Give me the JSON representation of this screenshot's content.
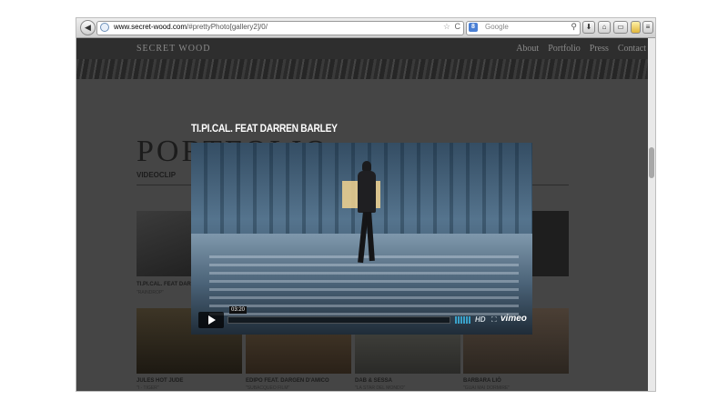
{
  "browser": {
    "url_host": "www.secret-wood.com",
    "url_path": "/#prettyPhoto[gallery2]/0/",
    "search_engine_label": "8",
    "search_placeholder": "Google"
  },
  "site": {
    "logo": "SECRET WOOD",
    "nav": [
      "About",
      "Portfolio",
      "Press",
      "Contact"
    ],
    "page_heading": "PORTFOLIO",
    "section_label": "VIDEOCLIP",
    "thumbs": [
      {
        "title": "TI.PI.CAL. FEAT DARREN B",
        "subtitle": "\"RAINDROP\""
      },
      {
        "title": "JULES HOT JUDE",
        "subtitle": "\"I - TIGER\""
      },
      {
        "title": "EDIPO FEAT. DARGEN D'AMICO",
        "subtitle": "\"SUBACQUEO FILM\""
      },
      {
        "title": "DAB & SESSA",
        "subtitle": "\"LA STAR DEL MONDO\""
      },
      {
        "title": "BARBARA LIÒ",
        "subtitle": "\"GUAI MAI DORMIRE\""
      }
    ]
  },
  "lightbox": {
    "title": "TI.PI.CAL. FEAT DARREN BARLEY",
    "time": "03:20",
    "hd_label": "HD",
    "brand": "vimeo"
  }
}
